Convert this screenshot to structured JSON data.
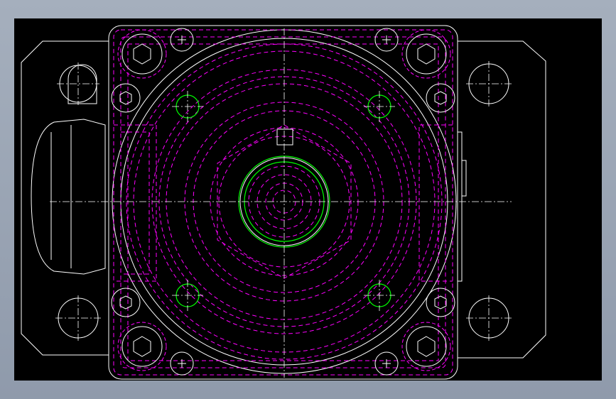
{
  "drawing": {
    "background": "#000000",
    "colors": {
      "outline": "#ffffff",
      "hidden": "#ff00ff",
      "highlight": "#00ff00"
    },
    "views": [
      "top-view"
    ]
  }
}
